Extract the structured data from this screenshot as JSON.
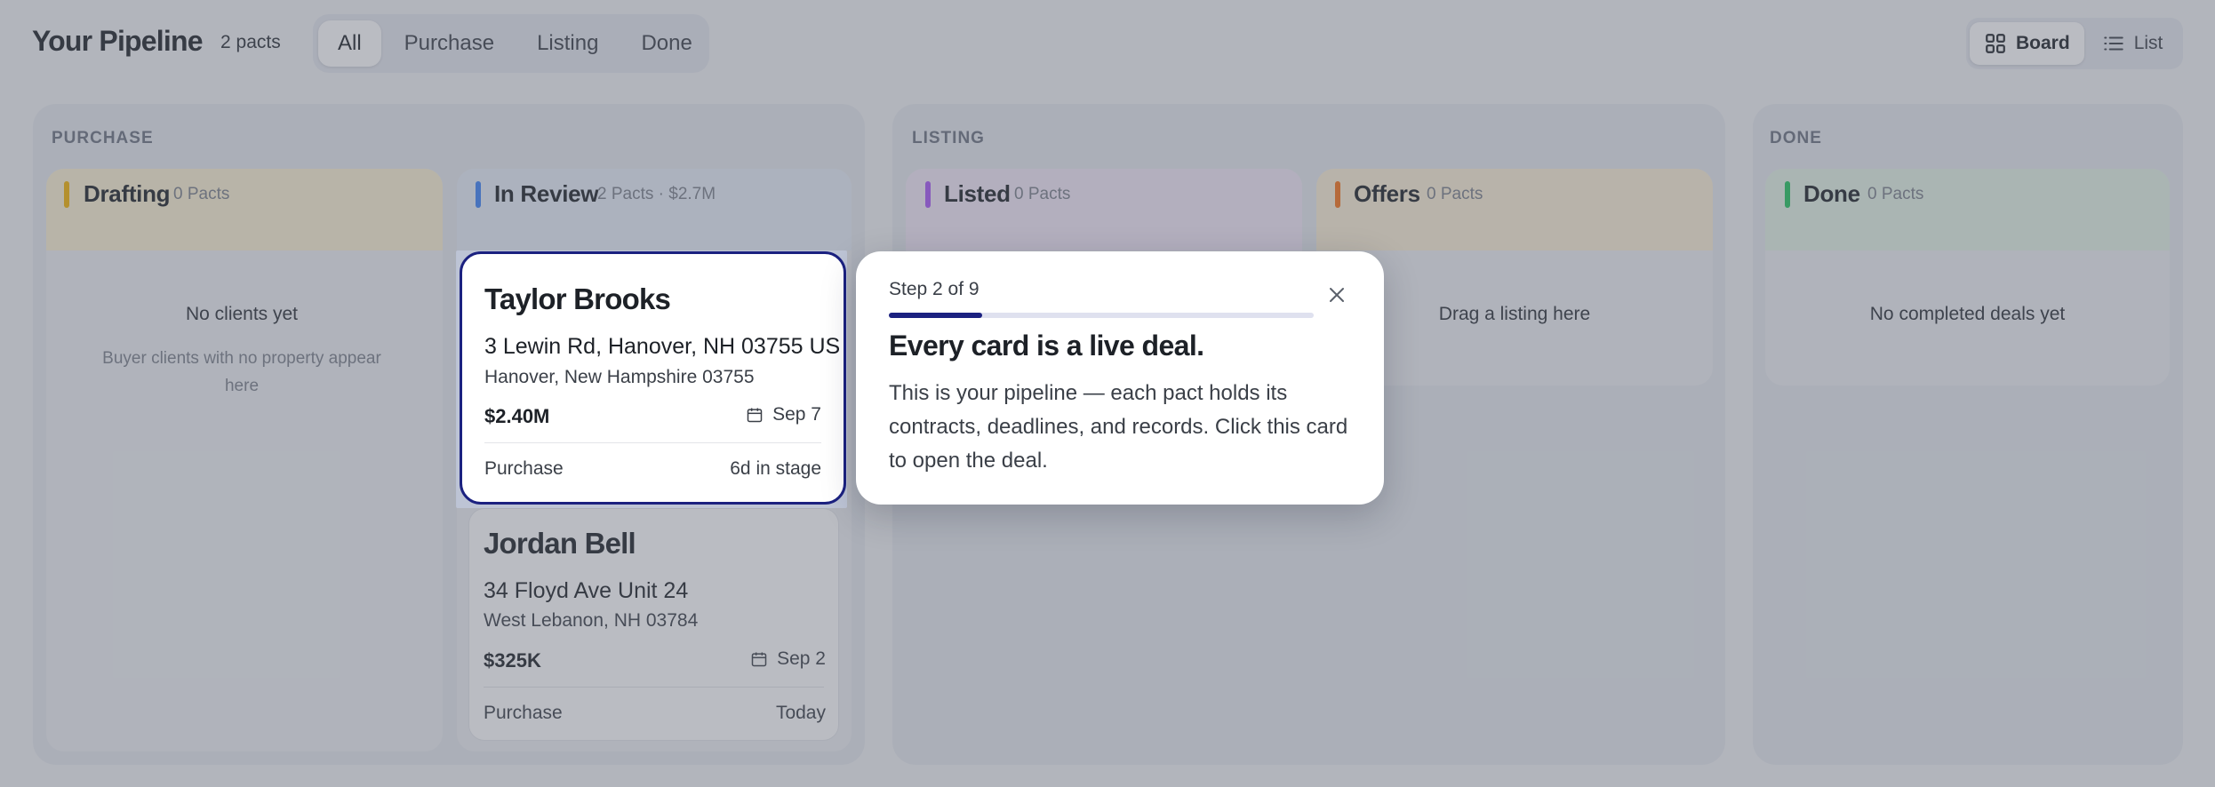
{
  "header": {
    "title": "Your Pipeline",
    "count": "2 pacts",
    "filters": [
      {
        "label": "All",
        "active": true
      },
      {
        "label": "Purchase",
        "active": false
      },
      {
        "label": "Listing",
        "active": false
      },
      {
        "label": "Done",
        "active": false
      }
    ],
    "views": [
      {
        "label": "Board",
        "icon": "grid-icon",
        "active": true
      },
      {
        "label": "List",
        "icon": "list-icon",
        "active": false
      }
    ]
  },
  "groups": [
    {
      "label": "PURCHASE"
    },
    {
      "label": "LISTING"
    },
    {
      "label": "DONE"
    }
  ],
  "columns": [
    {
      "name": "Drafting",
      "meta": "0 Pacts",
      "color": "#f5b301",
      "header_bg": "#fbf2d3",
      "empty_title": "No clients yet",
      "empty_sub": "Buyer clients with no property appear here"
    },
    {
      "name": "In Review",
      "meta": "2 Pacts · $2.7M",
      "color": "#3b82f6",
      "header_bg": "#e7eef9"
    },
    {
      "name": "Listed",
      "meta": "0 Pacts",
      "color": "#a855f7",
      "header_bg": "#f3e8f8"
    },
    {
      "name": "Offers",
      "meta": "0 Pacts",
      "color": "#f97316",
      "header_bg": "#fbefd6",
      "empty_title": "Drag a listing here"
    },
    {
      "name": "Done",
      "meta": "0 Pacts",
      "color": "#22c55e",
      "header_bg": "#e4f3e6",
      "empty_title": "No completed deals yet"
    }
  ],
  "cards": [
    {
      "client": "Taylor Brooks",
      "address": "3 Lewin Rd, Hanover, NH 03755 US",
      "city": "Hanover, New Hampshire 03755",
      "price": "$2.40M",
      "date": "Sep 7",
      "type": "Purchase",
      "age": "6d in stage"
    },
    {
      "client": "Jordan Bell",
      "address": "34 Floyd Ave Unit 24",
      "city": "West Lebanon, NH 03784",
      "price": "$325K",
      "date": "Sep 2",
      "type": "Purchase",
      "age": "Today"
    }
  ],
  "tour": {
    "step": "Step 2 of 9",
    "progress": 0.22,
    "heading": "Every card is a live deal.",
    "body": "This is your pipeline — each pact holds its contracts, deadlines, and records. Click this card to open the deal.",
    "accent": "#1b2180",
    "highlight_border": "#1b2180"
  },
  "icons": {
    "calendar": "calendar-icon",
    "close": "close-icon"
  }
}
